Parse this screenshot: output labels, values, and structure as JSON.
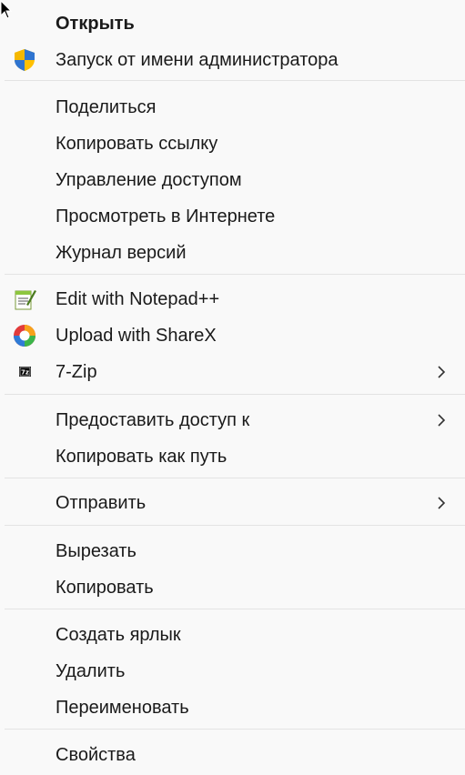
{
  "menu": {
    "items": [
      {
        "label": "Открыть",
        "bold": true
      },
      {
        "label": "Запуск от имени администратора",
        "icon": "shield-icon"
      },
      {
        "label": "Поделиться"
      },
      {
        "label": "Копировать ссылку"
      },
      {
        "label": "Управление доступом"
      },
      {
        "label": "Просмотреть в Интернете"
      },
      {
        "label": "Журнал версий"
      },
      {
        "label": "Edit with Notepad++",
        "icon": "notepadpp-icon"
      },
      {
        "label": "Upload with ShareX",
        "icon": "sharex-icon"
      },
      {
        "label": "7-Zip",
        "icon": "7zip-icon",
        "submenu": true
      },
      {
        "label": "Предоставить доступ к",
        "submenu": true
      },
      {
        "label": "Копировать как путь"
      },
      {
        "label": "Отправить",
        "submenu": true
      },
      {
        "label": "Вырезать"
      },
      {
        "label": "Копировать"
      },
      {
        "label": "Создать ярлык"
      },
      {
        "label": "Удалить"
      },
      {
        "label": "Переименовать"
      },
      {
        "label": "Свойства"
      }
    ],
    "icon_labels": {
      "sevenzip": "7z"
    },
    "colors": {
      "background": "#f9f9f9",
      "separator": "#e3e3e3",
      "text": "#1a1a1a"
    }
  }
}
